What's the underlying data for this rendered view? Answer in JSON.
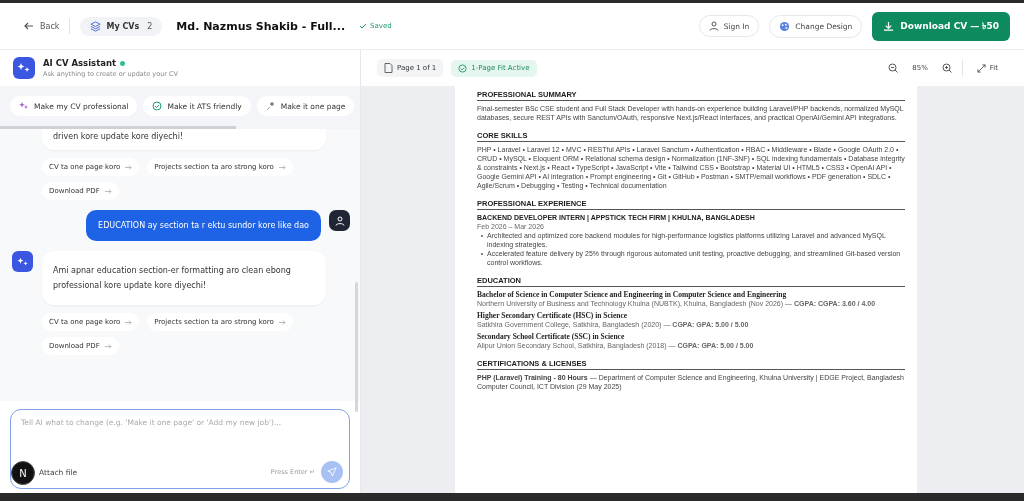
{
  "header": {
    "back": "Back",
    "my_cvs": {
      "label": "My CVs",
      "count": "2"
    },
    "title": "Md. Nazmus Shakib - Full...",
    "saved": "Saved",
    "sign_in": "Sign In",
    "change_design": "Change Design",
    "download": "Download CV — ৳50"
  },
  "assistant": {
    "title": "AI CV Assistant",
    "online": true,
    "subtitle": "Ask anything to create or update your CV"
  },
  "quick_actions": [
    "Make my CV professional",
    "Make it ATS friendly",
    "Make it one page"
  ],
  "messages": [
    {
      "kind": "assistant",
      "cut_top": true,
      "text": "driven kore update kore diyechi!",
      "suggestions": [
        "CV ta one page koro",
        "Projects section ta aro strong koro",
        "Download PDF"
      ]
    },
    {
      "kind": "user",
      "text": "EDUCATION ay section ta r ektu sundor kore like dao"
    },
    {
      "kind": "assistant",
      "cut_top": false,
      "text": "Ami apnar education section-er formatting aro clean ebong professional kore update kore diyechi!",
      "suggestions": [
        "CV ta one page koro",
        "Projects section ta aro strong koro",
        "Download PDF"
      ]
    }
  ],
  "composer": {
    "placeholder": "Tell AI what to change (e.g. 'Make it one page' or 'Add my new job')...",
    "attach": "Attach file",
    "hint": "Press Enter ↵",
    "send_disabled": true
  },
  "dev_badge": "N",
  "toolbar": {
    "page": "Page 1 of 1",
    "fit": "1-Page Fit Active",
    "zoom": "85%",
    "fit_button": "Fit"
  },
  "cv": {
    "sections": [
      {
        "kind": "text",
        "title": "PROFESSIONAL SUMMARY",
        "text": "Final-semester BSc CSE student and Full Stack Developer with hands-on experience building Laravel/PHP backends, normalized MySQL databases, secure REST APIs with Sanctum/OAuth, responsive Next.js/React interfaces, and practical OpenAI/Gemini API integrations."
      },
      {
        "kind": "text",
        "title": "CORE SKILLS",
        "text": "PHP • Laravel • Laravel 12 • MVC • RESTful APIs • Laravel Sanctum • Authentication • RBAC • Middleware • Blade • Google OAuth 2.0 • CRUD • MySQL • Eloquent ORM • Relational schema design • Normalization (1NF-3NF) • SQL indexing fundamentals • Database integrity & constraints • Next.js • React • TypeScript • JavaScript • Vite • Tailwind CSS • Bootstrap • Material UI • HTML5 • CSS3 • OpenAI API • Google Gemini API • AI integration • Prompt engineering • Git • GitHub • Postman • SMTP/email workflows • PDF generation • SDLC • Agile/Scrum • Debugging • Testing • Technical documentation"
      },
      {
        "kind": "jobs",
        "title": "PROFESSIONAL EXPERIENCE",
        "items": [
          {
            "role": "BACKEND DEVELOPER INTERN | APPSTICK TECH FIRM | KHULNA, BANGLADESH",
            "dates": "Feb 2026 – Mar 2026",
            "bullets": [
              "Architected and optimized core backend modules for high-performance logistics platforms utilizing Laravel and advanced MySQL indexing strategies.",
              "Accelerated feature delivery by 25% through rigorous automated unit testing, proactive debugging, and streamlined Git-based version control workflows."
            ]
          }
        ]
      },
      {
        "kind": "entries",
        "title": "EDUCATION",
        "items": [
          {
            "name": "Bachelor of Science in Computer Science and Engineering in Computer Science and Engineering",
            "detail": "Northern University of Business and Technology Khulna (NUBTK), Khulna, Bangladesh (Nov 2026) — **CGPA: CGPA: 3.60 / 4.00**"
          },
          {
            "name": "Higher Secondary Certificate (HSC) in Science",
            "detail": "Satkhira Government College, Satkhira, Bangladesh (2020) — **CGPA: GPA: 5.00 / 5.00**"
          },
          {
            "name": "Secondary School Certificate (SSC) in Science",
            "detail": "Alipur Union Secondary School, Satkhira, Bangladesh (2018) — **CGPA: GPA: 5.00 / 5.00**"
          }
        ]
      },
      {
        "kind": "text",
        "title": "CERTIFICATIONS & LICENSES",
        "text": "**PHP (Laravel) Training - 80 Hours** — Department of Computer Science and Engineering, Khulna University | EDGE Project, Bangladesh Computer Council, ICT Division (29 May 2025)"
      }
    ]
  }
}
